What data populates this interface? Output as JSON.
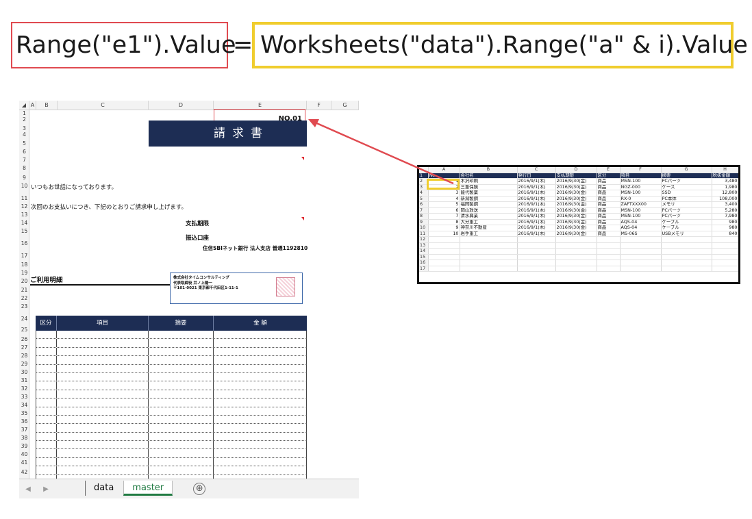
{
  "code": {
    "left": "Range(\"e1\").Value",
    "equals": "=",
    "right": "Worksheets(\"data\").Range(\"a\" & i).Value"
  },
  "master": {
    "columns": [
      "A",
      "B",
      "C",
      "D",
      "E",
      "F",
      "G"
    ],
    "rows": [
      "1",
      "2",
      "3",
      "4",
      "5",
      "6",
      "7",
      "8",
      "9",
      "10",
      "11",
      "12",
      "13",
      "14",
      "15",
      "16",
      "17",
      "18",
      "19",
      "20",
      "21",
      "22",
      "23",
      "24",
      "25",
      "26",
      "27",
      "28",
      "29",
      "30",
      "31",
      "32",
      "33",
      "34",
      "35",
      "36",
      "37",
      "38",
      "39",
      "40",
      "41",
      "42"
    ],
    "invoice_no": "NO.01",
    "title": "請求書",
    "greeting": "いつもお世話になっております。",
    "request": "次回のお支払いにつき、下記のとおりご請求申し上げます。",
    "payment_due_label": "支払期限",
    "bank_label": "振込口座",
    "bank_info": "住信SBIネット銀行 法人支店 普通1192810",
    "detail_title": "ご利用明細",
    "company": {
      "name": "株式会社タイムコンサルティング",
      "rep": "代表取締役 井ノ上陽一",
      "address": "〒101-0021 東京都千代田区1-11-1"
    },
    "detail_headers": [
      "区分",
      "項目",
      "摘要",
      "金 額"
    ],
    "tabs": {
      "data": "data",
      "master": "master",
      "add": "⊕"
    }
  },
  "datasheet": {
    "columns": [
      "",
      "A",
      "B",
      "C",
      "D",
      "E",
      "F",
      "G",
      "H"
    ],
    "header": [
      "1",
      "No.",
      "会社名",
      "発行日",
      "支払期限",
      "区分",
      "項目",
      "摘要",
      "税抜金額"
    ],
    "rows": [
      [
        "2",
        "1",
        "木沢印刷",
        "2016/9/1(木)",
        "2016/9/30(金)",
        "商品",
        "MSN-100",
        "PCパーツ",
        "3,480"
      ],
      [
        "3",
        "2",
        "三重保険",
        "2016/9/1(木)",
        "2016/9/30(金)",
        "商品",
        "NGZ-000",
        "ケース",
        "1,980"
      ],
      [
        "4",
        "3",
        "能代製薬",
        "2016/9/1(木)",
        "2016/9/30(金)",
        "商品",
        "MSN-100",
        "SSD",
        "12,800"
      ],
      [
        "5",
        "4",
        "新潟製鋼",
        "2016/9/1(木)",
        "2016/9/30(金)",
        "商品",
        "RX-0",
        "PC本体",
        "108,000"
      ],
      [
        "6",
        "5",
        "福岡製鋼",
        "2016/9/1(木)",
        "2016/9/30(金)",
        "商品",
        "ZAFTXXX00",
        "メモリ",
        "3,400"
      ],
      [
        "7",
        "6",
        "岡山放送",
        "2016/9/1(木)",
        "2016/9/30(金)",
        "商品",
        "MSN-100",
        "PCパーツ",
        "5,280"
      ],
      [
        "8",
        "7",
        "清水興業",
        "2016/9/1(木)",
        "2016/9/30(金)",
        "商品",
        "MSN-100",
        "PCパーツ",
        "7,980"
      ],
      [
        "9",
        "8",
        "大分重工",
        "2016/9/1(木)",
        "2016/9/30(金)",
        "商品",
        "AQS-04",
        "ケーブル",
        "980"
      ],
      [
        "10",
        "9",
        "神奈川不動産",
        "2016/9/1(木)",
        "2016/9/30(金)",
        "商品",
        "AQS-04",
        "ケーブル",
        "980"
      ],
      [
        "11",
        "10",
        "岩手重工",
        "2016/9/1(木)",
        "2016/9/30(金)",
        "商品",
        "MS-06S",
        "USBメモリ",
        "840"
      ],
      [
        "12",
        "",
        "",
        "",
        "",
        "",
        "",
        "",
        ""
      ],
      [
        "13",
        "",
        "",
        "",
        "",
        "",
        "",
        "",
        ""
      ],
      [
        "14",
        "",
        "",
        "",
        "",
        "",
        "",
        "",
        ""
      ],
      [
        "15",
        "",
        "",
        "",
        "",
        "",
        "",
        "",
        ""
      ],
      [
        "16",
        "",
        "",
        "",
        "",
        "",
        "",
        "",
        ""
      ],
      [
        "17",
        "",
        "",
        "",
        "",
        "",
        "",
        "",
        ""
      ]
    ]
  },
  "colors": {
    "navy": "#1d2d54",
    "annotation_red": "#e04a50",
    "annotation_yellow": "#f0cd2e",
    "tab_green": "#1f7a41"
  }
}
